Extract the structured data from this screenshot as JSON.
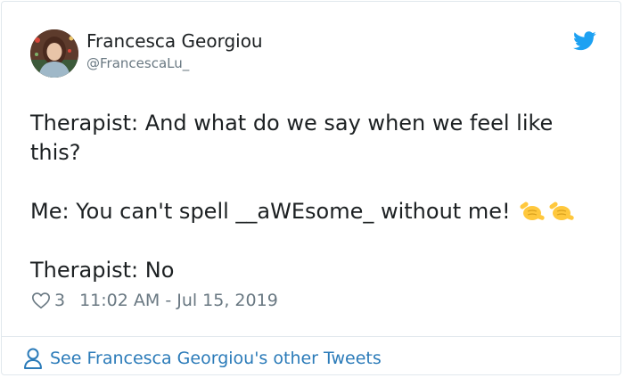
{
  "colors": {
    "accent": "#2b7bb9",
    "twitter_blue": "#1da1f2",
    "muted": "#697882",
    "text": "#1c2022",
    "border": "#e1e8ed"
  },
  "author": {
    "display_name": "Francesca Georgiou",
    "handle": "@FrancescaLu_"
  },
  "header": {
    "logo_icon": "twitter-bird-icon"
  },
  "tweet": {
    "line1": "Therapist: And what do we say when we feel like this?",
    "line2": "Me: You can't spell __aWEsome_ without me!",
    "line2_emojis": [
      "call-me-hand-emoji",
      "call-me-hand-emoji"
    ],
    "line3": "Therapist: No"
  },
  "meta": {
    "like_icon": "heart-icon",
    "like_count": "3",
    "timestamp": "11:02 AM - Jul 15, 2019"
  },
  "footer": {
    "icon": "person-icon",
    "link_text": "See Francesca Georgiou's other Tweets"
  }
}
